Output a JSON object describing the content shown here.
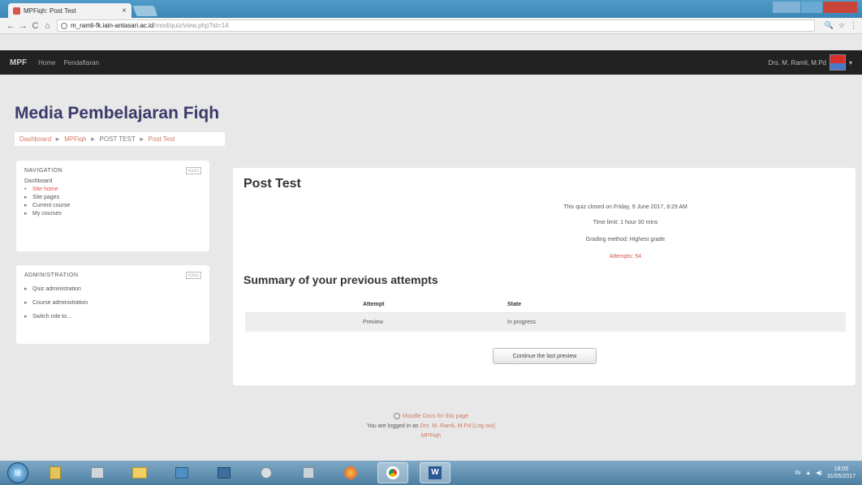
{
  "browser": {
    "tab_title": "MPFiqh: Post Test",
    "tab_close": "×",
    "url_host": "m_ramli-fk.iain-antasari.ac.id",
    "url_path": "/mod/quiz/view.php?id=14",
    "back": "←",
    "forward": "→",
    "reload": "C",
    "home": "⌂",
    "zoom": "🔍",
    "star": "☆",
    "menu": "⋮"
  },
  "navbar": {
    "brand": "MPF",
    "links": [
      "Home",
      "Pendaftaran"
    ],
    "username": "Drs. M. Ramli, M.Pd",
    "caret": "▾"
  },
  "page": {
    "title": "Media Pembelajaran Fiqh",
    "breadcrumb": [
      "Dashboard",
      "MPFiqh",
      "POST TEST",
      "Post Test"
    ],
    "breadcrumb_sep": "►"
  },
  "nav_block": {
    "title": "NAVIGATION",
    "ctrl": "▭▭",
    "dashboard": "Dashboard",
    "items": [
      "Site home",
      "Site pages",
      "Current course",
      "My courses"
    ]
  },
  "admin_block": {
    "title": "ADMINISTRATION",
    "ctrl": "▭▭",
    "items": [
      "Quiz administration",
      "Course administration",
      "Switch role to..."
    ]
  },
  "quiz": {
    "title": "Post Test",
    "closed": "This quiz closed on Friday, 9 June 2017, 8:29 AM",
    "time_limit": "Time limit: 1 hour 30 mins",
    "grading": "Grading method: Highest grade",
    "attempts": "Attempts: 54",
    "summary_title": "Summary of your previous attempts",
    "table_headers": [
      "Attempt",
      "State"
    ],
    "table_rows": [
      [
        "Preview",
        "In progress"
      ]
    ],
    "continue_label": "Continue the last preview"
  },
  "footer": {
    "docs": "Moodle Docs for this page",
    "logged_prefix": "You are logged in as",
    "user_link": "Drs. M. Ramli, M.Pd (Log out)",
    "course": "MPFiqh"
  },
  "taskbar": {
    "start": "⊞",
    "lang": "IN",
    "time": "18:05",
    "date": "31/05/2017"
  },
  "colors": {
    "navbar": "#222222",
    "title": "#3a3a6a",
    "link": "#d07a64",
    "alert": "#d9534f"
  }
}
